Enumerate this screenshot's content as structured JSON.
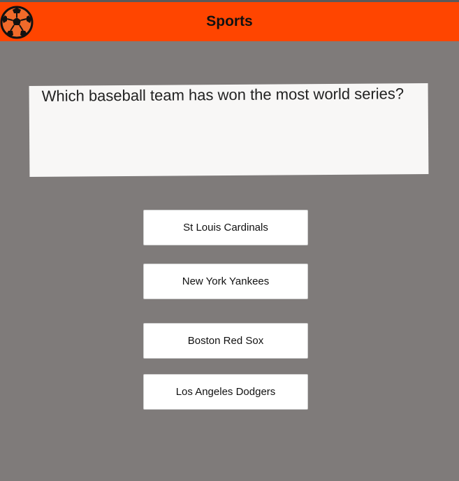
{
  "header": {
    "title": "Sports",
    "logo_icon": "soccer-ball-icon",
    "background_color": "#ff4500"
  },
  "question": {
    "text": "Which baseball team has won the most world series?"
  },
  "answers": [
    {
      "label": "St Louis Cardinals"
    },
    {
      "label": "New York Yankees"
    },
    {
      "label": "Boston Red Sox"
    },
    {
      "label": "Los Angeles Dodgers"
    }
  ],
  "colors": {
    "background": "#7f7b7a",
    "card": "#f8f7f6",
    "button": "#ffffff"
  }
}
